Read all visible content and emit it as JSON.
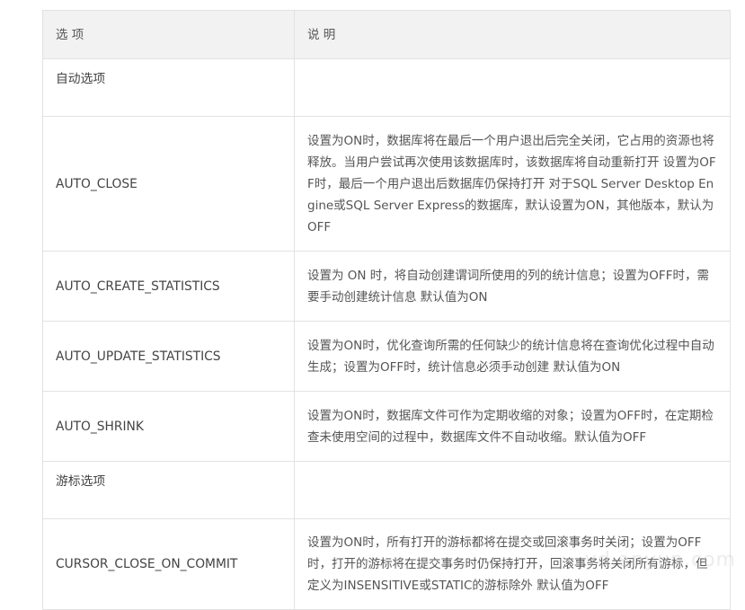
{
  "table": {
    "headers": [
      "选  项",
      "说  明"
    ],
    "rows": [
      {
        "name": "自动选项",
        "desc": "",
        "group": true
      },
      {
        "name": "AUTO_CLOSE",
        "desc": "设置为ON时，数据库将在最后一个用户退出后完全关闭，它占用的资源也将释放。当用户尝试再次使用该数据库时，该数据库将自动重新打开 设置为OFF时，最后一个用户退出后数据库仍保持打开 对于SQL Server Desktop Engine或SQL Server Express的数据库，默认设置为ON，其他版本，默认为OFF"
      },
      {
        "name": "AUTO_CREATE_STATISTICS",
        "desc": "设置为 ON 时，将自动创建谓词所使用的列的统计信息；设置为OFF时，需要手动创建统计信息 默认值为ON"
      },
      {
        "name": "AUTO_UPDATE_STATISTICS",
        "desc": "设置为ON时，优化查询所需的任何缺少的统计信息将在查询优化过程中自动生成；设置为OFF时，统计信息必须手动创建 默认值为ON"
      },
      {
        "name": "AUTO_SHRINK",
        "desc": "设置为ON时，数据库文件可作为定期收缩的对象；设置为OFF时，在定期检查未使用空间的过程中，数据库文件不自动收缩。默认值为OFF"
      },
      {
        "name": "游标选项",
        "desc": "",
        "group": true
      },
      {
        "name": "CURSOR_CLOSE_ON_COMMIT",
        "desc": "设置为ON时，所有打开的游标都将在提交或回滚事务时关闭；设置为OFF时，打开的游标将在提交事务时仍保持打开，回滚事务将关闭所有游标，但定义为INSENSITIVE或STATIC的游标除外 默认值为OFF"
      }
    ]
  },
  "watermark": "yd.anyun.com"
}
